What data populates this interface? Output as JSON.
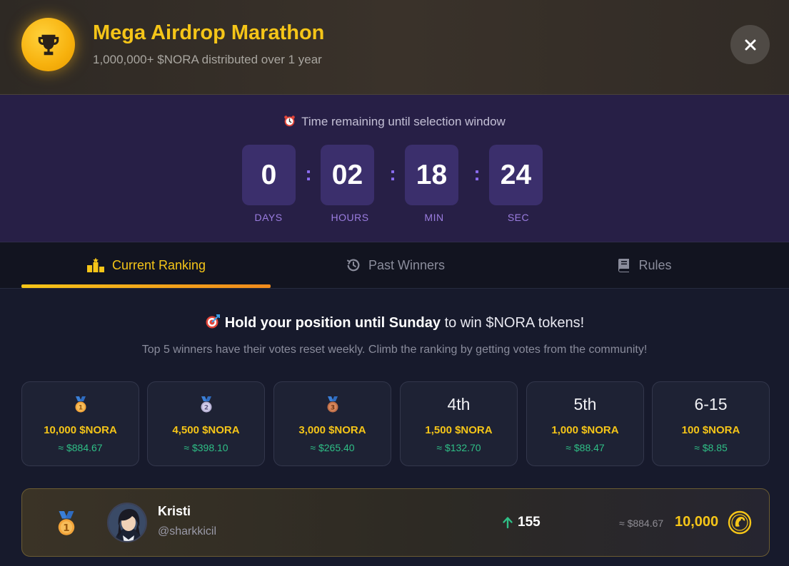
{
  "header": {
    "title": "Mega Airdrop Marathon",
    "subtitle": "1,000,000+ $NORA distributed over 1 year",
    "icon": "trophy-icon",
    "close_icon": "close-icon"
  },
  "countdown": {
    "icon": "alarm-clock-icon",
    "label": "Time remaining until selection window",
    "separator": ":",
    "units": [
      {
        "value": "0",
        "label": "DAYS"
      },
      {
        "value": "02",
        "label": "HOURS"
      },
      {
        "value": "18",
        "label": "MIN"
      },
      {
        "value": "24",
        "label": "SEC"
      }
    ]
  },
  "tabs": [
    {
      "label": "Current Ranking",
      "icon": "podium-icon",
      "active": true
    },
    {
      "label": "Past Winners",
      "icon": "history-icon",
      "active": false
    },
    {
      "label": "Rules",
      "icon": "book-icon",
      "active": false
    }
  ],
  "main": {
    "headline_icon": "target-icon",
    "headline_bold": "Hold your position until Sunday",
    "headline_rest": "to win $NORA tokens!",
    "subline": "Top 5 winners have their votes reset weekly. Climb the ranking by getting votes from the community!"
  },
  "prizes": [
    {
      "rank": "1",
      "icon": "gold-medal-icon",
      "amount": "10,000 $NORA",
      "usd": "≈ $884.67"
    },
    {
      "rank": "2",
      "icon": "silver-medal-icon",
      "amount": "4,500 $NORA",
      "usd": "≈ $398.10"
    },
    {
      "rank": "3",
      "icon": "bronze-medal-icon",
      "amount": "3,000 $NORA",
      "usd": "≈ $265.40"
    },
    {
      "rank": "4th",
      "amount": "1,500 $NORA",
      "usd": "≈ $132.70"
    },
    {
      "rank": "5th",
      "amount": "1,000 $NORA",
      "usd": "≈ $88.47"
    },
    {
      "rank": "6-15",
      "amount": "100 $NORA",
      "usd": "≈ $8.85"
    }
  ],
  "ranking": [
    {
      "position": "1",
      "medal_icon": "gold-medal-icon",
      "avatar_icon": "avatar",
      "name": "Kristi",
      "handle": "@sharkkicil",
      "vote_icon": "arrow-up-icon",
      "votes": "155",
      "usd": "≈ $884.67",
      "tokens": "10,000",
      "token_icon": "nora-coin-icon"
    }
  ],
  "colors": {
    "accent_gold": "#f5c518",
    "accent_purple": "#8b6cf0",
    "positive_green": "#2fbf86",
    "background": "#171a2c"
  }
}
